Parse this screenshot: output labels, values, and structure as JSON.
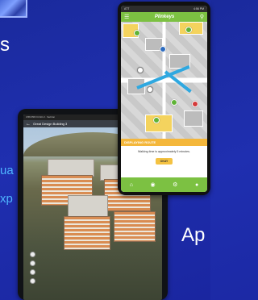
{
  "background_text": {
    "s": "s",
    "ua": "ua",
    "xp": "xp",
    "ap": "Ap"
  },
  "tablet": {
    "status": "4:56 PM  Fri Oct 2  ·  Verizon",
    "title": "Great Design Building 3",
    "back_icon": "back-arrow-icon"
  },
  "phone": {
    "status_left": "ATT",
    "status_right": "4:56 PM",
    "logo": "Plinkeys",
    "banner": "DISPLAYING ROUTE",
    "message": "Walking time is approximately 5 minutes.",
    "ok_label": "OKAY",
    "icons": [
      "menu-icon",
      "search-icon",
      "home-icon",
      "globe-icon",
      "settings-icon",
      "profile-icon"
    ]
  },
  "colors": {
    "background": "#1f2fb0",
    "app_green": "#7cc142",
    "banner_yellow": "#f4b73b",
    "route_blue": "#2fa8e0"
  }
}
